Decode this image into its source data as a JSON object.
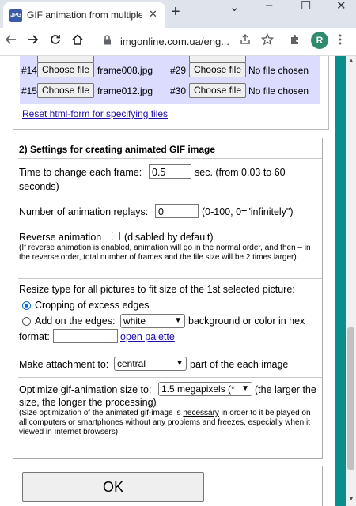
{
  "browser": {
    "tab_title": "GIF animation from multiple p",
    "tab_close": "✕",
    "new_tab": "+",
    "favicon_text": "JPG",
    "url": "imgonline.com.ua/eng...",
    "avatar_letter": "R",
    "window_controls": [
      "⌄",
      "–",
      "☐",
      "✕"
    ],
    "icons": [
      "back-icon",
      "forward-icon",
      "reload-icon",
      "home-icon",
      "lock-icon",
      "share-icon",
      "star-icon",
      "extensions-icon",
      "menu-icon"
    ]
  },
  "section1": {
    "file_rows": [
      {
        "num": "#14",
        "button": "Choose file",
        "file": "frame008.jpg",
        "num2": "#29",
        "button2": "Choose file",
        "file2": "No file chosen"
      },
      {
        "num": "#15",
        "button": "Choose file",
        "file": "frame012.jpg",
        "num2": "#30",
        "button2": "Choose file",
        "file2": "No file chosen"
      }
    ],
    "reset_link": "Reset html-form for specifying files"
  },
  "section2": {
    "title": "2) Settings for creating animated GIF image",
    "time_label": "Time to change each frame:",
    "time_value": "0.5",
    "time_unit": "sec. (from 0.03 to 60",
    "time_unit2": "seconds)",
    "replays_label": "Number of animation replays:",
    "replays_value": "0",
    "replays_hint": "(0-100, 0=\"infinitely\")",
    "reverse_label": "Reverse animation",
    "reverse_hint": "(disabled by default)",
    "reverse_note": "(If reverse animation is enabled, animation will go in the normal order, and then – in the reverse order, total number of frames and the file size will be 2 times larger)",
    "resize_label": "Resize type for all pictures to fit size of the 1st selected picture:",
    "crop_label": "Cropping of excess edges",
    "add_edges_label": "Add on the edges:",
    "edges_color": "white",
    "edges_suffix": "background or color in hex",
    "format_label": "format:",
    "hex_value": "",
    "palette_link": "open palette",
    "attach_label": "Make attachment to:",
    "attach_value": "central",
    "attach_suffix": "part of the each image",
    "optimize_label": "Optimize gif-animation size to:",
    "optimize_value": "1.5 megapixels (*",
    "optimize_suffix": "(the larger the",
    "optimize_suffix2": "size, the longer the processing)",
    "optimize_note_a": "(Size optimization of the animated gif-image is ",
    "optimize_note_b": "necessary",
    "optimize_note_c": " in order to it be played on all computers or smartphones without any problems and freezes, especially when it viewed in Internet browsers)"
  },
  "ok_label": "OK",
  "colors": {
    "teal": "#0a8d8d",
    "file_bg": "#dcdcff",
    "link": "#1a0dab"
  }
}
